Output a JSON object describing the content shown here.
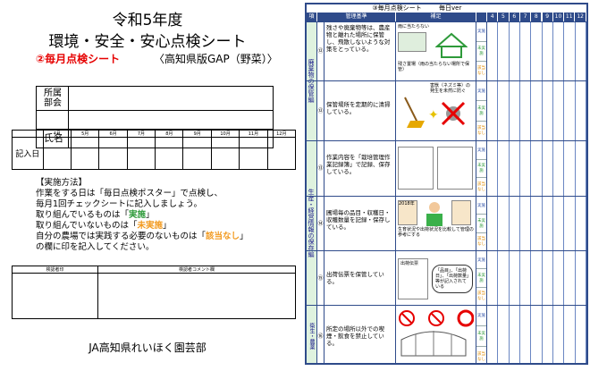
{
  "left": {
    "title_line1": "令和5年度",
    "title_line2": "環境・安全・安心点検シート",
    "subtitle_red": "②毎月点検シート",
    "subtitle_black": "〈高知県版GAP（野菜）〉",
    "info_labels": [
      "所属部会",
      "",
      "氏名"
    ],
    "months": [
      "4月",
      "5月",
      "6月",
      "7月",
      "8月",
      "9月",
      "10月",
      "11月",
      "12月"
    ],
    "entry_label": "記入日",
    "method_title": "【実施方法】",
    "method_lines": [
      "作業をする日は「毎日点検ポスター」で点検し、",
      "毎月1回チェックシートに記入しましょう。"
    ],
    "line_ok_pre": "取り組んでいるものは「",
    "line_ok_word": "実施",
    "line_ok_post": "」",
    "line_ng_pre": "取り組んでいないものは「",
    "line_ng_word": "未実施",
    "line_ng_post": "」",
    "line_na_pre": "自分の農場では実践する必要のないものは「",
    "line_na_word": "該当なし",
    "line_na_post": "」",
    "method_last": "の欄に印を記入してください。",
    "checker_label": "検認者印",
    "comment_label": "検認者コメント欄",
    "footer": "JA高知県れいほく園芸部"
  },
  "right": {
    "sheet_title": "③毎月点検シート",
    "version": "毎日ver",
    "headers": [
      "項目",
      "管理基準",
      "補足",
      "",
      "4",
      "5",
      "6",
      "7",
      "8",
      "9",
      "10",
      "11",
      "12"
    ],
    "categories": [
      "廃棄物の保管編",
      "生産・経営情報の保存編",
      "衛生・農薬"
    ],
    "rows": [
      {
        "num": "⑫",
        "desc": "残さや廃棄物等は、農産物と離れた場所に保管し、飛散しないような対策をとっている。",
        "note_top": "雨に当たらない",
        "note_bottom": "残さ置場（雨の当たらない場所で保管）"
      },
      {
        "num": "⑫",
        "desc": "保管場所を定期的に清掃している。",
        "note_top": "害獣（ネズミ等）の発生を未然に防ぐ",
        "note_bottom": ""
      },
      {
        "num": "⑬",
        "desc": "作業内容を「栽培管理作業記録簿」で記録、保存している。",
        "note_top": "",
        "note_bottom": ""
      },
      {
        "num": "⑭",
        "desc": "圃場毎の品目・収穫日・収穫数量を記録・保存している。",
        "note_top": "2018年",
        "note_bottom": "生育状況や出荷状況を比較して管理の参考にする"
      },
      {
        "num": "⑮",
        "desc": "出荷伝票を保管している。",
        "note_top": "出荷伝票",
        "note_bottom": "「品目」、「出荷日」、「出荷数量」等が記入されている"
      },
      {
        "num": "⑯",
        "desc": "所定の場所以外での喫煙・飲食を禁止している。",
        "note_top": "",
        "note_bottom": ""
      }
    ],
    "choices": [
      "実施",
      "未実施",
      "該当なし"
    ]
  }
}
